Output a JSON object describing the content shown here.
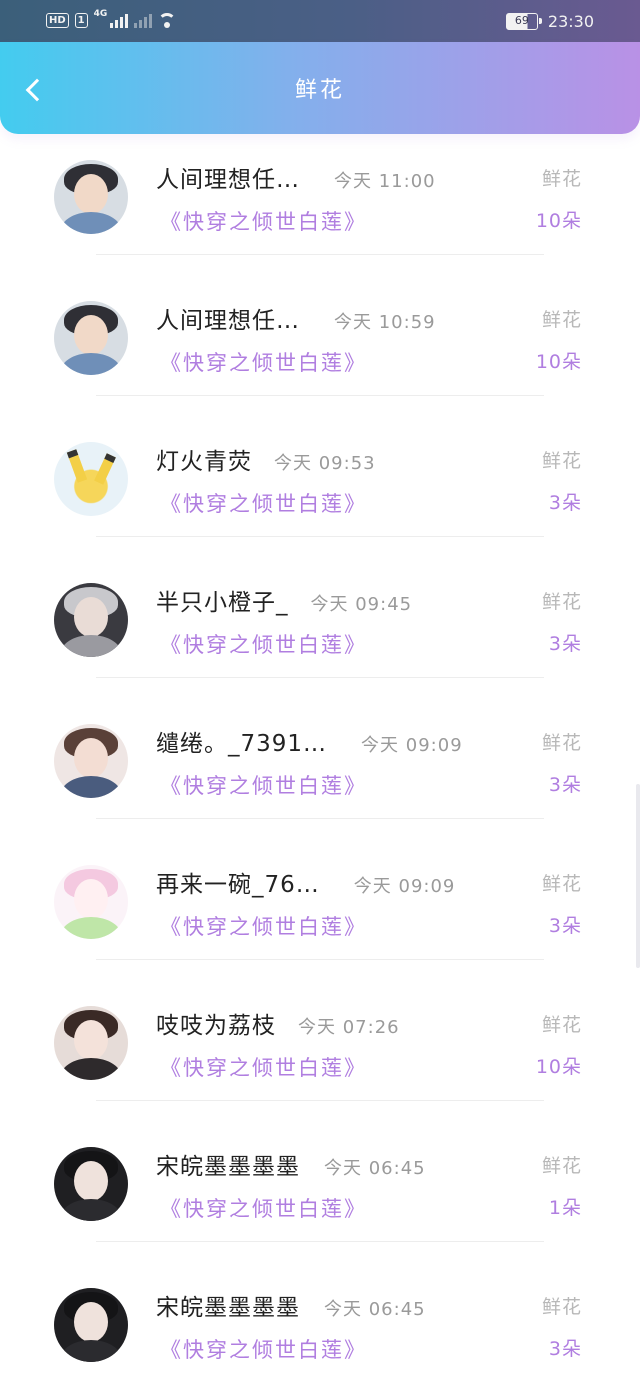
{
  "status_bar": {
    "left_badges": [
      "HD",
      "1"
    ],
    "network": "4G",
    "battery": "69",
    "time": "23:30"
  },
  "header": {
    "title": "鲜花",
    "back_icon": "chevron-left-icon"
  },
  "colors": {
    "header_gradient_start": "#43ccef",
    "header_gradient_end": "#b991e6",
    "accent_purple": "#b07ee0",
    "name_text": "#222222",
    "muted_text": "#9a9a9a"
  },
  "list": {
    "items": [
      {
        "name": "人间理想任…",
        "time": "今天 11:00",
        "book": "《快穿之倾世白莲》",
        "gift_label": "鲜花",
        "gift_count": "10朵"
      },
      {
        "name": "人间理想任…",
        "time": "今天 10:59",
        "book": "《快穿之倾世白莲》",
        "gift_label": "鲜花",
        "gift_count": "10朵"
      },
      {
        "name": "灯火青荧",
        "time": "今天 09:53",
        "book": "《快穿之倾世白莲》",
        "gift_label": "鲜花",
        "gift_count": "3朵"
      },
      {
        "name": "半只小橙子_",
        "time": "今天 09:45",
        "book": "《快穿之倾世白莲》",
        "gift_label": "鲜花",
        "gift_count": "3朵"
      },
      {
        "name": "缱绻。_7391…",
        "time": "今天 09:09",
        "book": "《快穿之倾世白莲》",
        "gift_label": "鲜花",
        "gift_count": "3朵"
      },
      {
        "name": "再来一碗_76…",
        "time": "今天 09:09",
        "book": "《快穿之倾世白莲》",
        "gift_label": "鲜花",
        "gift_count": "3朵"
      },
      {
        "name": "吱吱为荔枝",
        "time": "今天 07:26",
        "book": "《快穿之倾世白莲》",
        "gift_label": "鲜花",
        "gift_count": "10朵"
      },
      {
        "name": "宋皖墨墨墨墨",
        "time": "今天 06:45",
        "book": "《快穿之倾世白莲》",
        "gift_label": "鲜花",
        "gift_count": "1朵"
      },
      {
        "name": "宋皖墨墨墨墨",
        "time": "今天 06:45",
        "book": "《快穿之倾世白莲》",
        "gift_label": "鲜花",
        "gift_count": "3朵"
      }
    ]
  }
}
